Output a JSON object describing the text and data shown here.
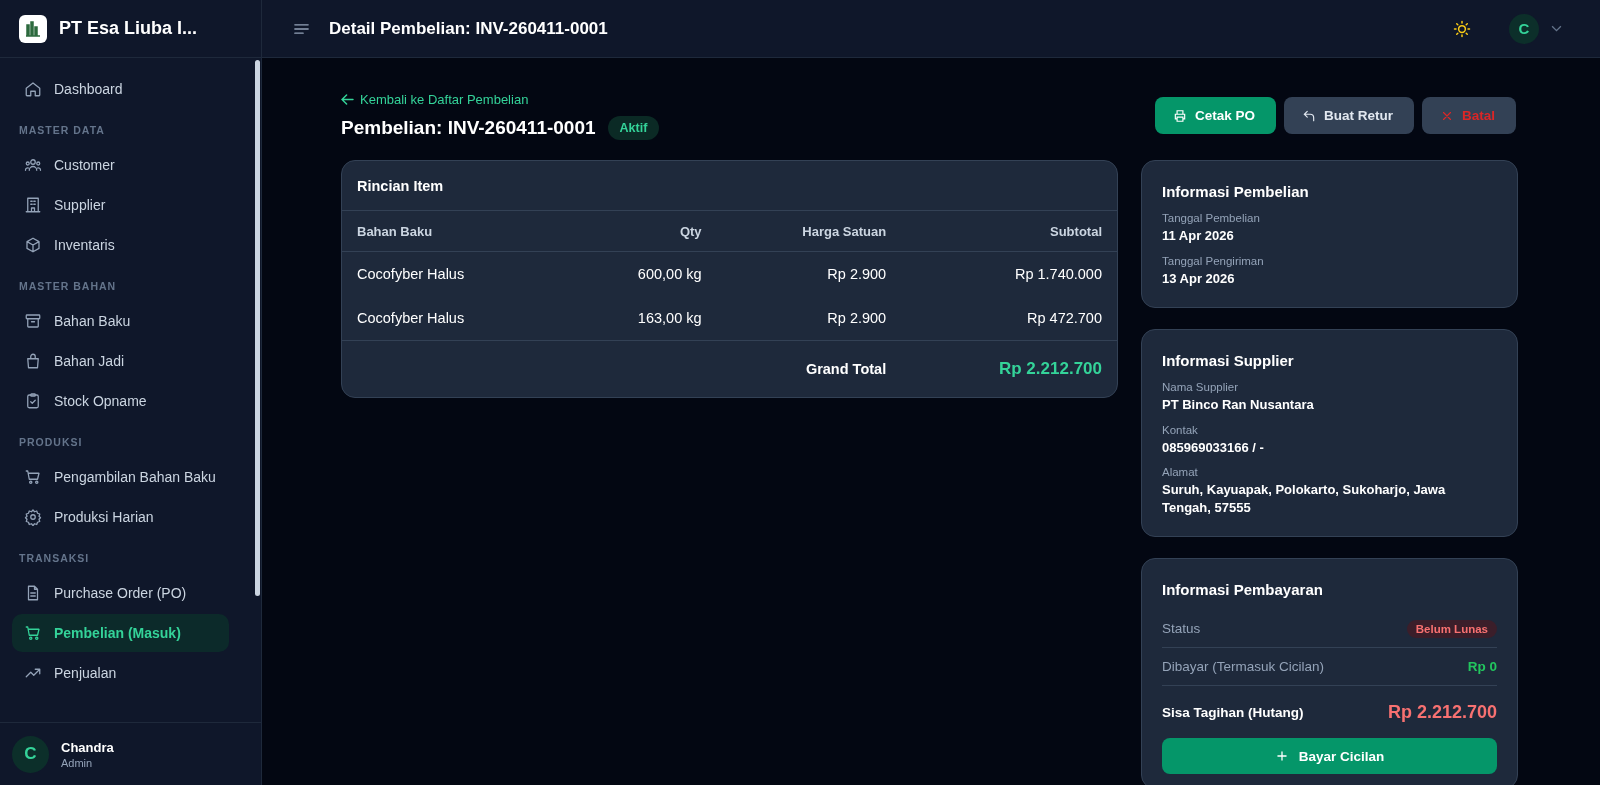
{
  "brand": {
    "name": "PT Esa Liuba I..."
  },
  "sidebar": {
    "sections": [
      {
        "items": [
          {
            "label": "Dashboard",
            "selected": false
          }
        ]
      },
      {
        "title": "MASTER DATA",
        "items": [
          {
            "label": "Customer",
            "selected": false
          },
          {
            "label": "Supplier",
            "selected": false
          },
          {
            "label": "Inventaris",
            "selected": false
          }
        ]
      },
      {
        "title": "MASTER BAHAN",
        "items": [
          {
            "label": "Bahan Baku",
            "selected": false
          },
          {
            "label": "Bahan Jadi",
            "selected": false
          },
          {
            "label": "Stock Opname",
            "selected": false
          }
        ]
      },
      {
        "title": "PRODUKSI",
        "items": [
          {
            "label": "Pengambilan Bahan Baku",
            "selected": false
          },
          {
            "label": "Produksi Harian",
            "selected": false
          }
        ]
      },
      {
        "title": "TRANSAKSI",
        "items": [
          {
            "label": "Purchase Order (PO)",
            "selected": false
          },
          {
            "label": "Pembelian (Masuk)",
            "selected": true
          },
          {
            "label": "Penjualan",
            "selected": false
          }
        ]
      }
    ],
    "user": {
      "initial": "C",
      "name": "Chandra",
      "role": "Admin"
    }
  },
  "header": {
    "title": "Detail Pembelian: INV-260411-0001",
    "avatar_initial": "C"
  },
  "back_link": "Kembali ke Daftar Pembelian",
  "page_title": "Pembelian: INV-260411-0001",
  "status_badge": "Aktif",
  "actions": [
    {
      "label": "Cetak PO",
      "kind": "primary"
    },
    {
      "label": "Buat Retur",
      "kind": "secondary"
    },
    {
      "label": "Batal",
      "kind": "danger"
    }
  ],
  "items_card": {
    "title": "Rincian Item",
    "columns": [
      "Bahan Baku",
      "Qty",
      "Harga Satuan",
      "Subtotal"
    ],
    "rows": [
      [
        "Cocofyber Halus",
        "600,00 kg",
        "Rp 2.900",
        "Rp 1.740.000"
      ],
      [
        "Cocofyber Halus",
        "163,00 kg",
        "Rp 2.900",
        "Rp 472.700"
      ]
    ],
    "total_label": "Grand Total",
    "total_value": "Rp 2.212.700"
  },
  "purchase_info": {
    "title": "Informasi Pembelian",
    "fields": [
      {
        "label": "Tanggal Pembelian",
        "value": "11 Apr 2026"
      },
      {
        "label": "Tanggal Pengiriman",
        "value": "13 Apr 2026"
      }
    ]
  },
  "supplier_info": {
    "title": "Informasi Supplier",
    "fields": [
      {
        "label": "Nama Supplier",
        "value": "PT Binco Ran Nusantara"
      },
      {
        "label": "Kontak",
        "value": "085969033166 / -"
      },
      {
        "label": "Alamat",
        "value": "Suruh, Kayuapak, Polokarto, Sukoharjo, Jawa Tengah, 57555"
      }
    ]
  },
  "payment_info": {
    "title": "Informasi Pembayaran",
    "status_label": "Status",
    "status": "Belum Lunas",
    "paid_label": "Dibayar (Termasuk Cicilan)",
    "paid_value": "Rp 0",
    "due_label": "Sisa Tagihan (Hutang)",
    "due_value": "Rp 2.212.700",
    "button": "Bayar Cicilan"
  }
}
